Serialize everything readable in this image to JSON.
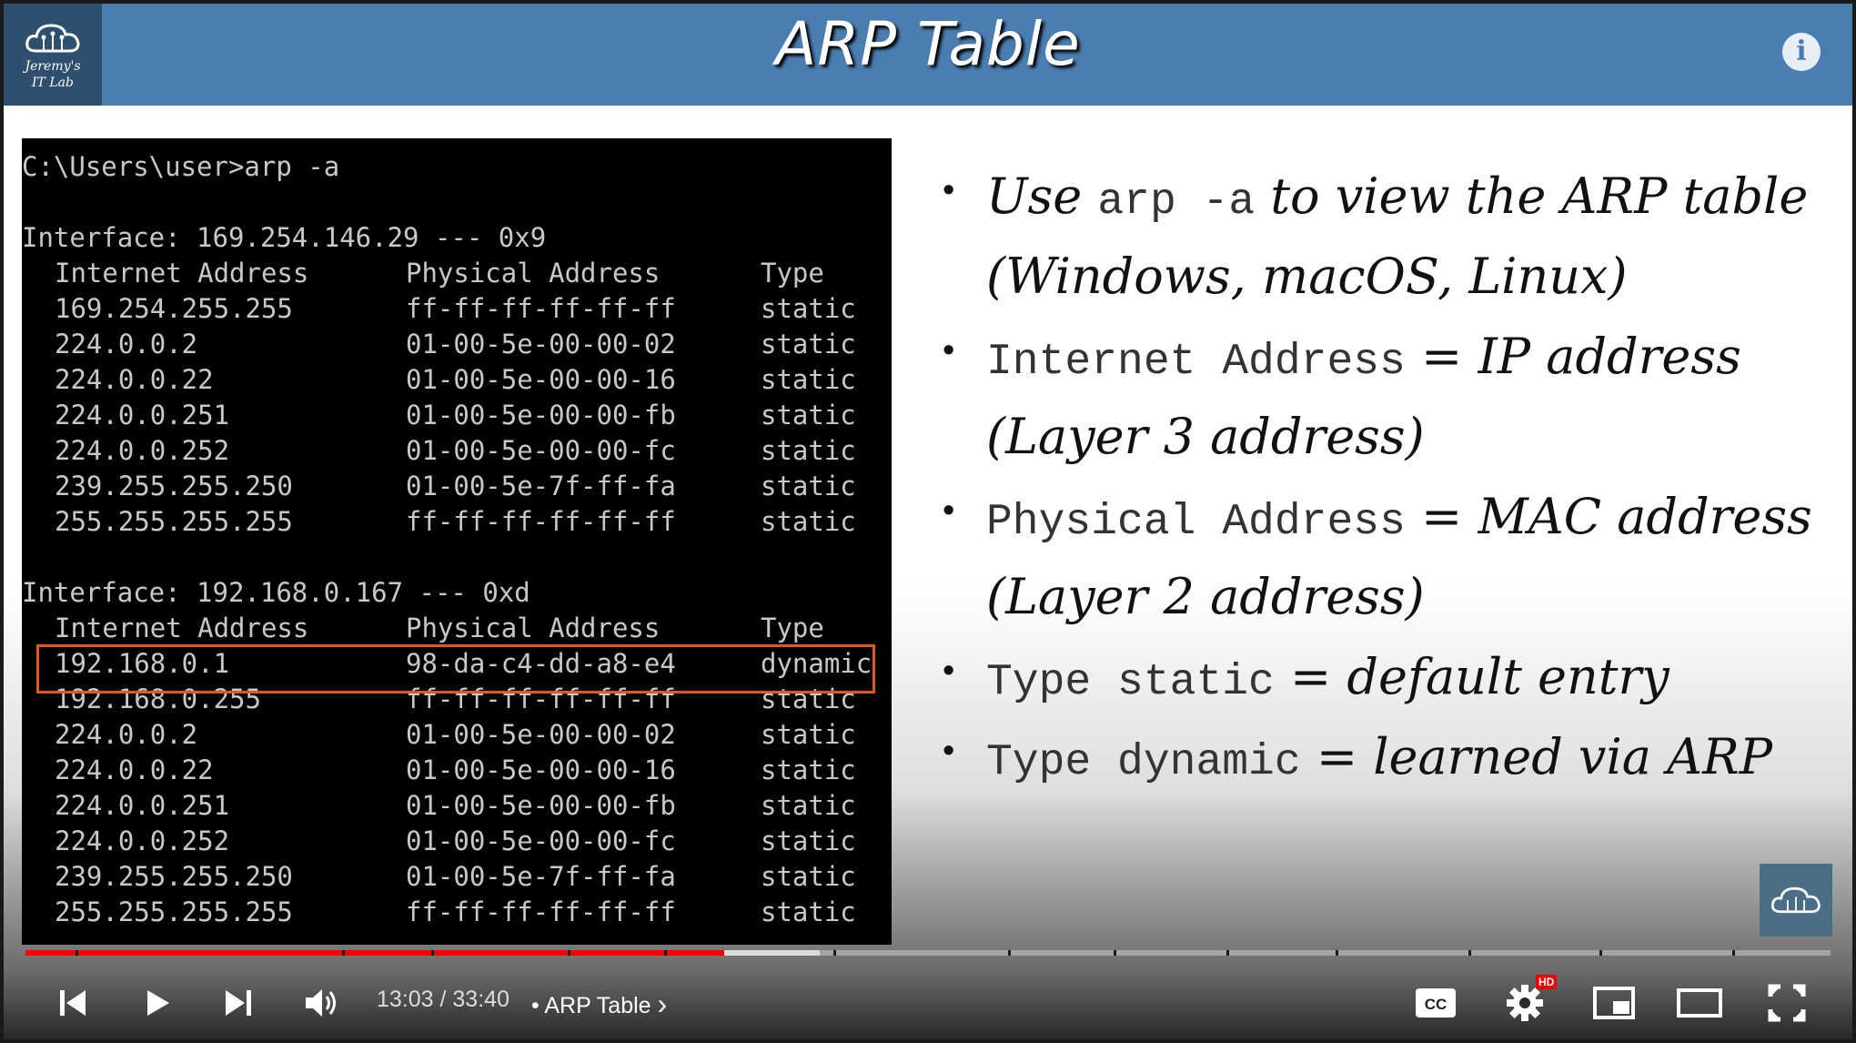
{
  "slide": {
    "title": "ARP Table",
    "logo_line1": "Jeremy's",
    "logo_line2": "IT Lab",
    "info_icon": "i"
  },
  "terminal": {
    "command": "C:\\Users\\user>arp -a",
    "interfaces": [
      {
        "header": "Interface: 169.254.146.29 --- 0x9",
        "columns": [
          "Internet Address",
          "Physical Address",
          "Type"
        ],
        "rows": [
          [
            "169.254.255.255",
            "ff-ff-ff-ff-ff-ff",
            "static"
          ],
          [
            "224.0.0.2",
            "01-00-5e-00-00-02",
            "static"
          ],
          [
            "224.0.0.22",
            "01-00-5e-00-00-16",
            "static"
          ],
          [
            "224.0.0.251",
            "01-00-5e-00-00-fb",
            "static"
          ],
          [
            "224.0.0.252",
            "01-00-5e-00-00-fc",
            "static"
          ],
          [
            "239.255.255.250",
            "01-00-5e-7f-ff-fa",
            "static"
          ],
          [
            "255.255.255.255",
            "ff-ff-ff-ff-ff-ff",
            "static"
          ]
        ]
      },
      {
        "header": "Interface: 192.168.0.167 --- 0xd",
        "columns": [
          "Internet Address",
          "Physical Address",
          "Type"
        ],
        "rows": [
          [
            "192.168.0.1",
            "98-da-c4-dd-a8-e4",
            "dynamic"
          ],
          [
            "192.168.0.255",
            "ff-ff-ff-ff-ff-ff",
            "static"
          ],
          [
            "224.0.0.2",
            "01-00-5e-00-00-02",
            "static"
          ],
          [
            "224.0.0.22",
            "01-00-5e-00-00-16",
            "static"
          ],
          [
            "224.0.0.251",
            "01-00-5e-00-00-fb",
            "static"
          ],
          [
            "224.0.0.252",
            "01-00-5e-00-00-fc",
            "static"
          ],
          [
            "239.255.255.250",
            "01-00-5e-7f-ff-fa",
            "static"
          ],
          [
            "255.255.255.255",
            "ff-ff-ff-ff-ff-ff",
            "static"
          ]
        ]
      }
    ]
  },
  "bullets": [
    {
      "line1": [
        {
          "t": "Use ",
          "s": "hand"
        },
        {
          "t": "arp -a",
          "s": "mono"
        },
        {
          "t": " to view the ARP table",
          "s": "hand"
        }
      ],
      "line2": "(Windows, macOS, Linux)"
    },
    {
      "line1": [
        {
          "t": "Internet Address",
          "s": "mono"
        },
        {
          "t": " = IP address",
          "s": "hand"
        }
      ],
      "line2": "(Layer 3 address)"
    },
    {
      "line1": [
        {
          "t": "Physical Address",
          "s": "mono"
        },
        {
          "t": " = MAC address",
          "s": "hand"
        }
      ],
      "line2": "(Layer 2 address)"
    },
    {
      "line1": [
        {
          "t": "Type static",
          "s": "mono"
        },
        {
          "t": " = default entry",
          "s": "hand"
        }
      ]
    },
    {
      "line1": [
        {
          "t": "Type dynamic",
          "s": "mono"
        },
        {
          "t": " = learned via ARP",
          "s": "hand"
        }
      ]
    }
  ],
  "player": {
    "current_time": "13:03",
    "duration": "33:40",
    "separator": " / ",
    "chapter_dot": "•",
    "chapter_title": "ARP Table",
    "chapter_arrow": "›",
    "progress_fraction": 0.387,
    "buffered_fraction": 0.44,
    "hd_badge": "HD",
    "cc_label": "CC",
    "colors": {
      "played": "#ff0000",
      "title_bar": "#4a7db0",
      "highlight": "#e05a1e"
    }
  }
}
